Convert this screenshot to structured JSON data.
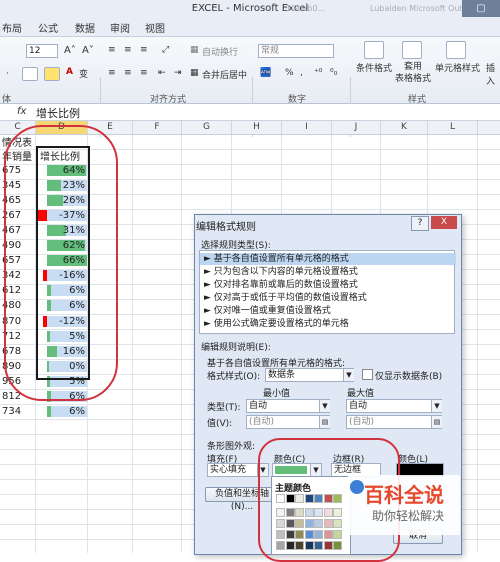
{
  "window": {
    "title": "EXCEL - Microsoft Excel",
    "ghost_left": "1Gbab0...",
    "ghost_right": "Lubaiden Microsoft Outlook"
  },
  "tabs": [
    "布局",
    "公式",
    "数据",
    "审阅",
    "视图"
  ],
  "ribbon": {
    "font_size": "12",
    "wrap_text": "自动换行",
    "merge_center": "合并后居中",
    "number_format": "常规",
    "cond_format": "条件格式",
    "table_format": "套用\n表格格式",
    "cell_style": "单元格样式",
    "insert": "插入",
    "groups": {
      "font": "体",
      "alignment": "对齐方式",
      "number": "数字",
      "styles": "样式"
    }
  },
  "formula_bar": {
    "fx": "fx",
    "value": "增长比例"
  },
  "columns": [
    "C",
    "D",
    "E",
    "F",
    "G",
    "H",
    "I",
    "J",
    "K",
    "L"
  ],
  "header_cells": {
    "c1": "情况表",
    "c2": "年销量",
    "d2": "增长比例"
  },
  "rows": [
    {
      "c": "675",
      "pct": "64%",
      "v": 0.64
    },
    {
      "c": "345",
      "pct": "23%",
      "v": 0.23
    },
    {
      "c": "465",
      "pct": "26%",
      "v": 0.26
    },
    {
      "c": "267",
      "pct": "-37%",
      "v": -0.37
    },
    {
      "c": "467",
      "pct": "31%",
      "v": 0.31
    },
    {
      "c": "490",
      "pct": "62%",
      "v": 0.62
    },
    {
      "c": "657",
      "pct": "66%",
      "v": 0.66
    },
    {
      "c": "342",
      "pct": "-16%",
      "v": -0.16
    },
    {
      "c": "612",
      "pct": "6%",
      "v": 0.06
    },
    {
      "c": "480",
      "pct": "6%",
      "v": 0.06
    },
    {
      "c": "870",
      "pct": "-12%",
      "v": -0.12
    },
    {
      "c": "712",
      "pct": "5%",
      "v": 0.05
    },
    {
      "c": "678",
      "pct": "16%",
      "v": 0.16
    },
    {
      "c": "890",
      "pct": "0%",
      "v": 0.0
    },
    {
      "c": "956",
      "pct": "5%",
      "v": 0.05
    },
    {
      "c": "812",
      "pct": "6%",
      "v": 0.06
    },
    {
      "c": "734",
      "pct": "6%",
      "v": 0.06
    }
  ],
  "colors": {
    "positive_bar": "#63be7b",
    "negative_bar": "#ff0000",
    "highlight": "#d0333e"
  },
  "dialog": {
    "title": "编辑格式规则",
    "help": "?",
    "close": "X",
    "select_rule_type": "选择规则类型(S):",
    "rules": [
      "► 基于各自值设置所有单元格的格式",
      "► 只为包含以下内容的单元格设置格式",
      "► 仅对排名靠前或靠后的数值设置格式",
      "► 仅对高于或低于平均值的数值设置格式",
      "► 仅对唯一值或重复值设置格式",
      "► 使用公式确定要设置格式的单元格"
    ],
    "edit_desc": "编辑规则说明(E):",
    "desc_line": "基于各自值设置所有单元格的格式:",
    "format_style_label": "格式样式(O):",
    "format_style_value": "数据条",
    "show_bar_only": "仅显示数据条(B)",
    "min_label": "最小值",
    "max_label": "最大值",
    "type_label": "类型(T):",
    "value_label": "值(V):",
    "auto": "自动",
    "auto_paren": "(自动)",
    "appearance": "条形图外观:",
    "fill_label": "填充(F)",
    "fill_value": "实心填充",
    "color_label": "颜色(C)",
    "border_label": "边框(R)",
    "border_value": "无边框",
    "color2_label": "颜色(L)",
    "neg_axis_btn": "负值和坐标轴(N)...",
    "cancel": "取消",
    "theme_colors": "主题颜色"
  },
  "watermark": {
    "line1": "百科全说",
    "line2": "助你轻松解决"
  }
}
